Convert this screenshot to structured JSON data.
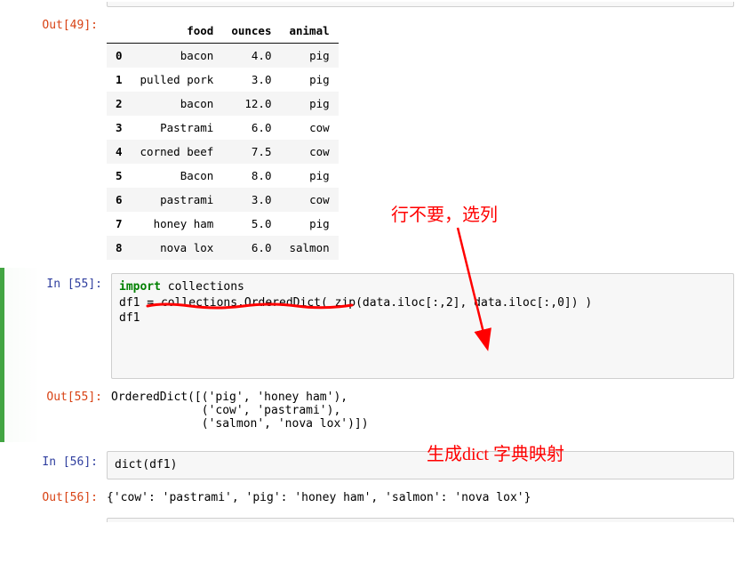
{
  "cells": {
    "out49": {
      "prompt": "Out[49]:",
      "table": {
        "columns": [
          "food",
          "ounces",
          "animal"
        ],
        "index": [
          "0",
          "1",
          "2",
          "3",
          "4",
          "5",
          "6",
          "7",
          "8"
        ],
        "rows": [
          [
            "bacon",
            "4.0",
            "pig"
          ],
          [
            "pulled pork",
            "3.0",
            "pig"
          ],
          [
            "bacon",
            "12.0",
            "pig"
          ],
          [
            "Pastrami",
            "6.0",
            "cow"
          ],
          [
            "corned beef",
            "7.5",
            "cow"
          ],
          [
            "Bacon",
            "8.0",
            "pig"
          ],
          [
            "pastrami",
            "3.0",
            "cow"
          ],
          [
            "honey ham",
            "5.0",
            "pig"
          ],
          [
            "nova lox",
            "6.0",
            "salmon"
          ]
        ]
      }
    },
    "in55": {
      "prompt": "In  [55]:",
      "code": {
        "line1_kw": "import",
        "line1_rest": " collections",
        "line2": "df1 = collections.OrderedDict( zip(data.iloc[:,2], data.iloc[:,0]) )",
        "line3": "df1"
      }
    },
    "out55": {
      "prompt": "Out[55]:",
      "text": "OrderedDict([('pig', 'honey ham'),\n             ('cow', 'pastrami'),\n             ('salmon', 'nova lox')])"
    },
    "in56": {
      "prompt": "In  [56]:",
      "code": "dict(df1)"
    },
    "out56": {
      "prompt": "Out[56]:",
      "text": "{'cow': 'pastrami', 'pig': 'honey ham', 'salmon': 'nova lox'}"
    }
  },
  "annotations": {
    "a1": "行不要，选列",
    "a2": "生成dict 字典映射"
  }
}
